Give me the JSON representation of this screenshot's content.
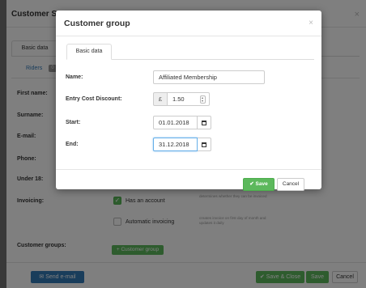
{
  "background": {
    "title": "Customer S",
    "close": "×",
    "tab_basic": "Basic data",
    "tab_riders": "Riders",
    "riders_count": "0",
    "labels": {
      "first_name": "First name:",
      "surname": "Surname:",
      "email": "E-mail:",
      "phone": "Phone:",
      "under18": "Under 18:",
      "invoicing": "Invoicing:",
      "customer_groups": "Customer groups:"
    },
    "has_account": {
      "label": "Has an account",
      "checked": true,
      "note": "determines whether they can be invoiced"
    },
    "auto_invoicing": {
      "label": "Automatic invoicing",
      "checked": false,
      "note": "creates invoice on first day of month and updates it daily"
    },
    "add_group_button": "+ Customer group",
    "send_email_button": "Send e-mail",
    "save_close_button": "Save & Close",
    "save_button": "Save",
    "cancel_button": "Cancel"
  },
  "dialog": {
    "title": "Customer group",
    "close": "×",
    "tab": "Basic data",
    "fields": {
      "name": {
        "label": "Name:",
        "value": "Affiliated Membership"
      },
      "discount": {
        "label": "Entry Cost Discount:",
        "currency": "£",
        "value": "1.50"
      },
      "start": {
        "label": "Start:",
        "value": "01.01.2018"
      },
      "end": {
        "label": "End:",
        "value": "31.12.2018"
      }
    },
    "save_button": "Save",
    "cancel_button": "Cancel"
  },
  "colors": {
    "primary": "#337ab7",
    "success": "#5cb85c",
    "overlay": "rgba(0,0,0,0.5)"
  }
}
